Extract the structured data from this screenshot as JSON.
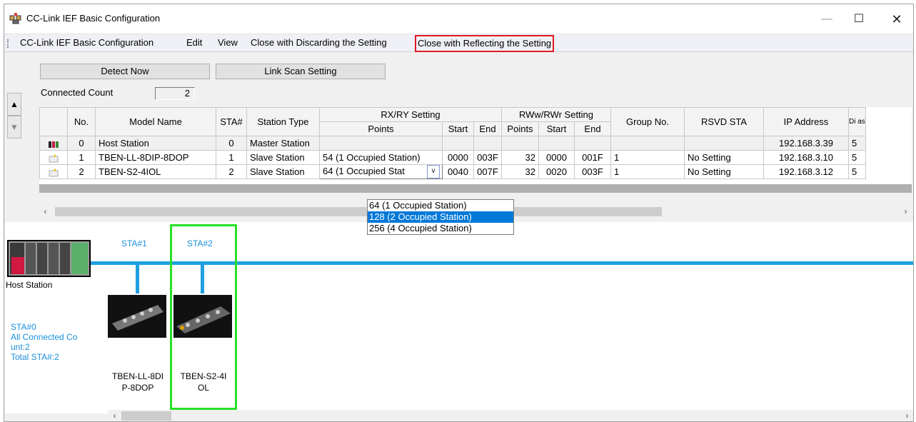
{
  "window": {
    "title": "CC-Link IEF Basic Configuration",
    "minimize_glyph": "—",
    "maximize_glyph": "☐",
    "close_glyph": "✕"
  },
  "menu": {
    "items": [
      "CC-Link IEF Basic Configuration",
      "Edit",
      "View",
      "Close with Discarding the Setting",
      "Close with Reflecting the Setting"
    ]
  },
  "toolbar": {
    "detect_now": "Detect Now",
    "link_scan_setting": "Link Scan Setting",
    "connected_count_label": "Connected Count",
    "connected_count": "2"
  },
  "nav": {
    "up_glyph": "▲",
    "down_glyph": "▼"
  },
  "table": {
    "headers": {
      "no": "No.",
      "model_name": "Model Name",
      "sta": "STA#",
      "station_type": "Station Type",
      "rxry": "RX/RY Setting",
      "rww": "RWw/RWr Setting",
      "points": "Points",
      "start": "Start",
      "end": "End",
      "group_no": "Group No.",
      "rsvd_sta": "RSVD STA",
      "ip_address": "IP Address",
      "extra": "Di as"
    },
    "rows": [
      {
        "no": "0",
        "model": "Host Station",
        "sta": "0",
        "type": "Master Station",
        "rx_points": "",
        "rx_start": "",
        "rx_end": "",
        "rw_points": "",
        "rw_start": "",
        "rw_end": "",
        "group": "",
        "rsvd": "",
        "ip": "192.168.3.39",
        "extra": "5"
      },
      {
        "no": "1",
        "model": "TBEN-LL-8DIP-8DOP",
        "sta": "1",
        "type": "Slave Station",
        "rx_points": "54 (1 Occupied Station)",
        "rx_start": "0000",
        "rx_end": "003F",
        "rw_points": "32",
        "rw_start": "0000",
        "rw_end": "001F",
        "group": "1",
        "rsvd": "No Setting",
        "ip": "192.168.3.10",
        "extra": "5"
      },
      {
        "no": "2",
        "model": "TBEN-S2-4IOL",
        "sta": "2",
        "type": "Slave Station",
        "rx_points": "64 (1 Occupied Stat",
        "rx_start": "0040",
        "rx_end": "007F",
        "rw_points": "32",
        "rw_start": "0020",
        "rw_end": "003F",
        "group": "1",
        "rsvd": "No Setting",
        "ip": "192.168.3.12",
        "extra": "5"
      }
    ]
  },
  "dropdown": {
    "options": [
      "64 (1 Occupied Station)",
      "128 (2 Occupied Station)",
      "256 (4 Occupied Station)"
    ],
    "selected_index": 1
  },
  "diagram": {
    "host_label": "Host Station",
    "sta1_label": "STA#1",
    "sta2_label": "STA#2",
    "device1_name_line1": "TBEN-LL-8DI",
    "device1_name_line2": "P-8DOP",
    "device2_name_line1": "TBEN-S2-4I",
    "device2_name_line2": "OL",
    "info_line1": "STA#0",
    "info_line2": "All Connected Co",
    "info_line3": "unt:2",
    "info_line4": "Total STA#:2"
  },
  "colors": {
    "highlight_red": "#e01b24",
    "selection_green": "#27e027",
    "bus_blue": "#1fa0e0",
    "list_selection": "#0078d7"
  }
}
